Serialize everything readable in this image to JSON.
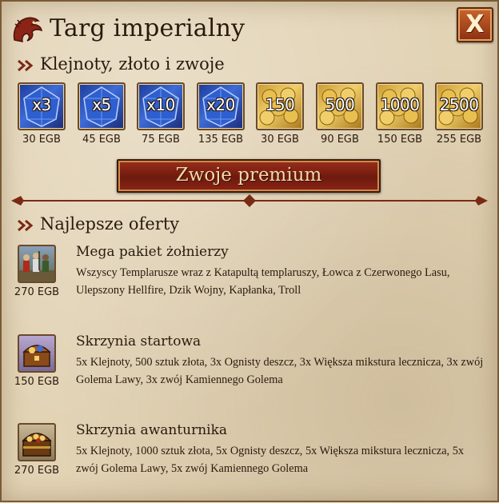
{
  "window": {
    "title": "Targ imperialny",
    "close_label": "X"
  },
  "section_currency": {
    "label": "Klejnoty, złoto i zwoje"
  },
  "items": [
    {
      "type": "gem",
      "qty": "x3",
      "price": "30 EGB"
    },
    {
      "type": "gem",
      "qty": "x5",
      "price": "45 EGB"
    },
    {
      "type": "gem",
      "qty": "x10",
      "price": "75 EGB"
    },
    {
      "type": "gem",
      "qty": "x20",
      "price": "135 EGB"
    },
    {
      "type": "gold",
      "qty": "150",
      "price": "30 EGB"
    },
    {
      "type": "gold",
      "qty": "500",
      "price": "90 EGB"
    },
    {
      "type": "gold",
      "qty": "1000",
      "price": "150 EGB"
    },
    {
      "type": "gold",
      "qty": "2500",
      "price": "255 EGB"
    }
  ],
  "premium_button": {
    "label": "Zwoje premium"
  },
  "section_offers": {
    "label": "Najlepsze oferty"
  },
  "offers": [
    {
      "name": "Mega pakiet żołnierzy",
      "description": "Wszyscy Templarusze wraz z Katapultą templaruszy, Łowca z Czerwonego Lasu, Ulepszony Hellfire, Dzik Wojny, Kapłanka, Troll",
      "price": "270 EGB",
      "icon": "soldiers-icon"
    },
    {
      "name": "Skrzynia startowa",
      "description": "5x Klejnoty, 500 sztuk złota, 3x Ognisty deszcz, 3x Większa mikstura lecznicza, 3x zwój Golema Lawy, 3x zwój Kamiennego Golema",
      "price": "150 EGB",
      "icon": "chest-icon"
    },
    {
      "name": "Skrzynia awanturnika",
      "description": "5x Klejnoty, 1000 sztuk złota, 5x Ognisty deszcz, 5x Większa mikstura lecznicza, 5x zwój Golema Lawy, 5x zwój Kamiennego Golema",
      "price": "270 EGB",
      "icon": "treasure-chest-icon"
    }
  ],
  "colors": {
    "parchment": "#e2d3b5",
    "ink": "#2a1a0e",
    "accent_red": "#8a2416",
    "gold": "#f0cf6a",
    "gem_blue": "#3d6bd8"
  }
}
